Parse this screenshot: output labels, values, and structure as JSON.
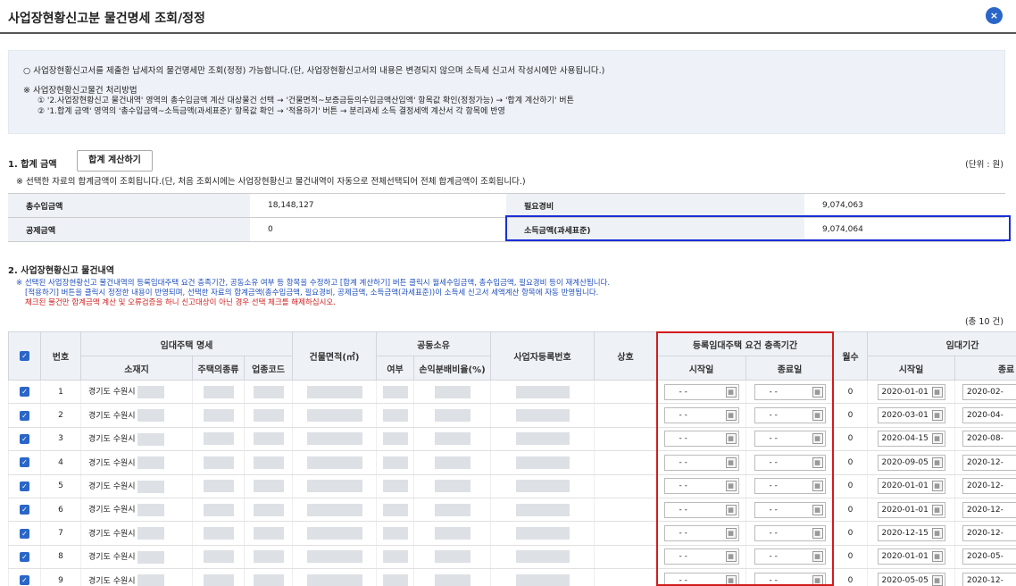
{
  "header": {
    "title": "사업장현황신고분 물건명세 조회/정정",
    "close_label": "×"
  },
  "info": {
    "line1": "○ 사업장현황신고서를 제출한 납세자의 물건명세만 조회(정정) 가능합니다.(단, 사업장현황신고서의 내용은 변경되지 않으며 소득세 신고서 작성시에만 사용됩니다.)",
    "line2": "※ 사업장현황신고물건 처리방법",
    "line3": "① '2.사업장현황신고 물건내역' 영역의 총수입금액 계산 대상물건 선택 → '건물면적~보증금등의수입금액산입액' 항목값 확인(정정가능) → '합계 계산하기' 버튼",
    "line4": "② '1.합계 금액' 영역의 '총수입금액~소득금액(과세표준)' 항목값 확인 → '적용하기' 버튼 → 분리과세 소득 결정세액 계산서 각 항목에 반영"
  },
  "section1": {
    "title": "1. 합계 금액",
    "calc_button": "합계 계산하기",
    "unit": "(단위 : 원)",
    "note": "※ 선택한 자료의 합계금액이 조회됩니다.(단, 처음 조회시에는 사업장현황신고 물건내역이 자동으로 전체선택되어 전체 합계금액이 조회됩니다.)",
    "rows": [
      {
        "k1": "총수입금액",
        "v1": "18,148,127",
        "k2": "필요경비",
        "v2": "9,074,063"
      },
      {
        "k1": "공제금액",
        "v1": "0",
        "k2": "소득금액(과세표준)",
        "v2": "9,074,064"
      }
    ]
  },
  "section2": {
    "title": "2. 사업장현황신고 물건내역",
    "note1": "※ 선택된 사업장현황신고 물건내역의 등록임대주택 요건 충족기간, 공동소유 여부 등 항목을 수정하고 [합계 계산하기] 버튼 클릭시 월세수입금액, 총수입금액, 필요경비 등이 재계산됩니다.",
    "note2": "[적용하기] 버튼을 클릭시 정정한 내용이 반영되며, 선택한 자료의 합계금액(총수입금액, 필요경비, 공제금액, 소득금액(과세표준))이 소득세 신고서 세액계산 항목에 자동 반영됩니다.",
    "note3": "체크된 물건만 합계금액 계산 및 오류검증을 하니 신고대상이 아닌 경우 선택 체크를 해제하십시오.",
    "count": "(총 10 건)"
  },
  "grid": {
    "headers": {
      "no": "번호",
      "rental": "임대주택 명세",
      "addr": "소재지",
      "htype": "주택의종류",
      "bcode": "업종코드",
      "area": "건물면적(㎡)",
      "joint": "공동소유",
      "yn": "여부",
      "ratio": "손익분배비율(%)",
      "bizno": "사업자등록번호",
      "trade": "상호",
      "period_req": "등록임대주택 요건 충족기간",
      "start": "시작일",
      "end": "종료일",
      "months": "월수",
      "rent_period": "임대기간",
      "rent_start": "시작일",
      "rent_end": "종료"
    },
    "rows": [
      {
        "no": "1",
        "addr": "경기도 수원시",
        "req_start": "- -",
        "req_end": "- -",
        "months": "0",
        "rent_start": "2020-01-01",
        "rent_end": "2020-02-"
      },
      {
        "no": "2",
        "addr": "경기도 수원시",
        "req_start": "- -",
        "req_end": "- -",
        "months": "0",
        "rent_start": "2020-03-01",
        "rent_end": "2020-04-"
      },
      {
        "no": "3",
        "addr": "경기도 수원시",
        "req_start": "- -",
        "req_end": "- -",
        "months": "0",
        "rent_start": "2020-04-15",
        "rent_end": "2020-08-"
      },
      {
        "no": "4",
        "addr": "경기도 수원시",
        "req_start": "- -",
        "req_end": "- -",
        "months": "0",
        "rent_start": "2020-09-05",
        "rent_end": "2020-12-"
      },
      {
        "no": "5",
        "addr": "경기도 수원시",
        "req_start": "- -",
        "req_end": "- -",
        "months": "0",
        "rent_start": "2020-01-01",
        "rent_end": "2020-12-"
      },
      {
        "no": "6",
        "addr": "경기도 수원시",
        "req_start": "- -",
        "req_end": "- -",
        "months": "0",
        "rent_start": "2020-01-01",
        "rent_end": "2020-12-"
      },
      {
        "no": "7",
        "addr": "경기도 수원시",
        "req_start": "- -",
        "req_end": "- -",
        "months": "0",
        "rent_start": "2020-12-15",
        "rent_end": "2020-12-"
      },
      {
        "no": "8",
        "addr": "경기도 수원시",
        "req_start": "- -",
        "req_end": "- -",
        "months": "0",
        "rent_start": "2020-01-01",
        "rent_end": "2020-05-"
      },
      {
        "no": "9",
        "addr": "경기도 수원시",
        "req_start": "- -",
        "req_end": "- -",
        "months": "0",
        "rent_start": "2020-05-05",
        "rent_end": "2020-12-"
      }
    ]
  },
  "colors": {
    "accent": "#2a66c8",
    "highlight_red": "#d21c1c",
    "highlight_blue": "#1a2fd6",
    "header_bg": "#eef1f6"
  }
}
